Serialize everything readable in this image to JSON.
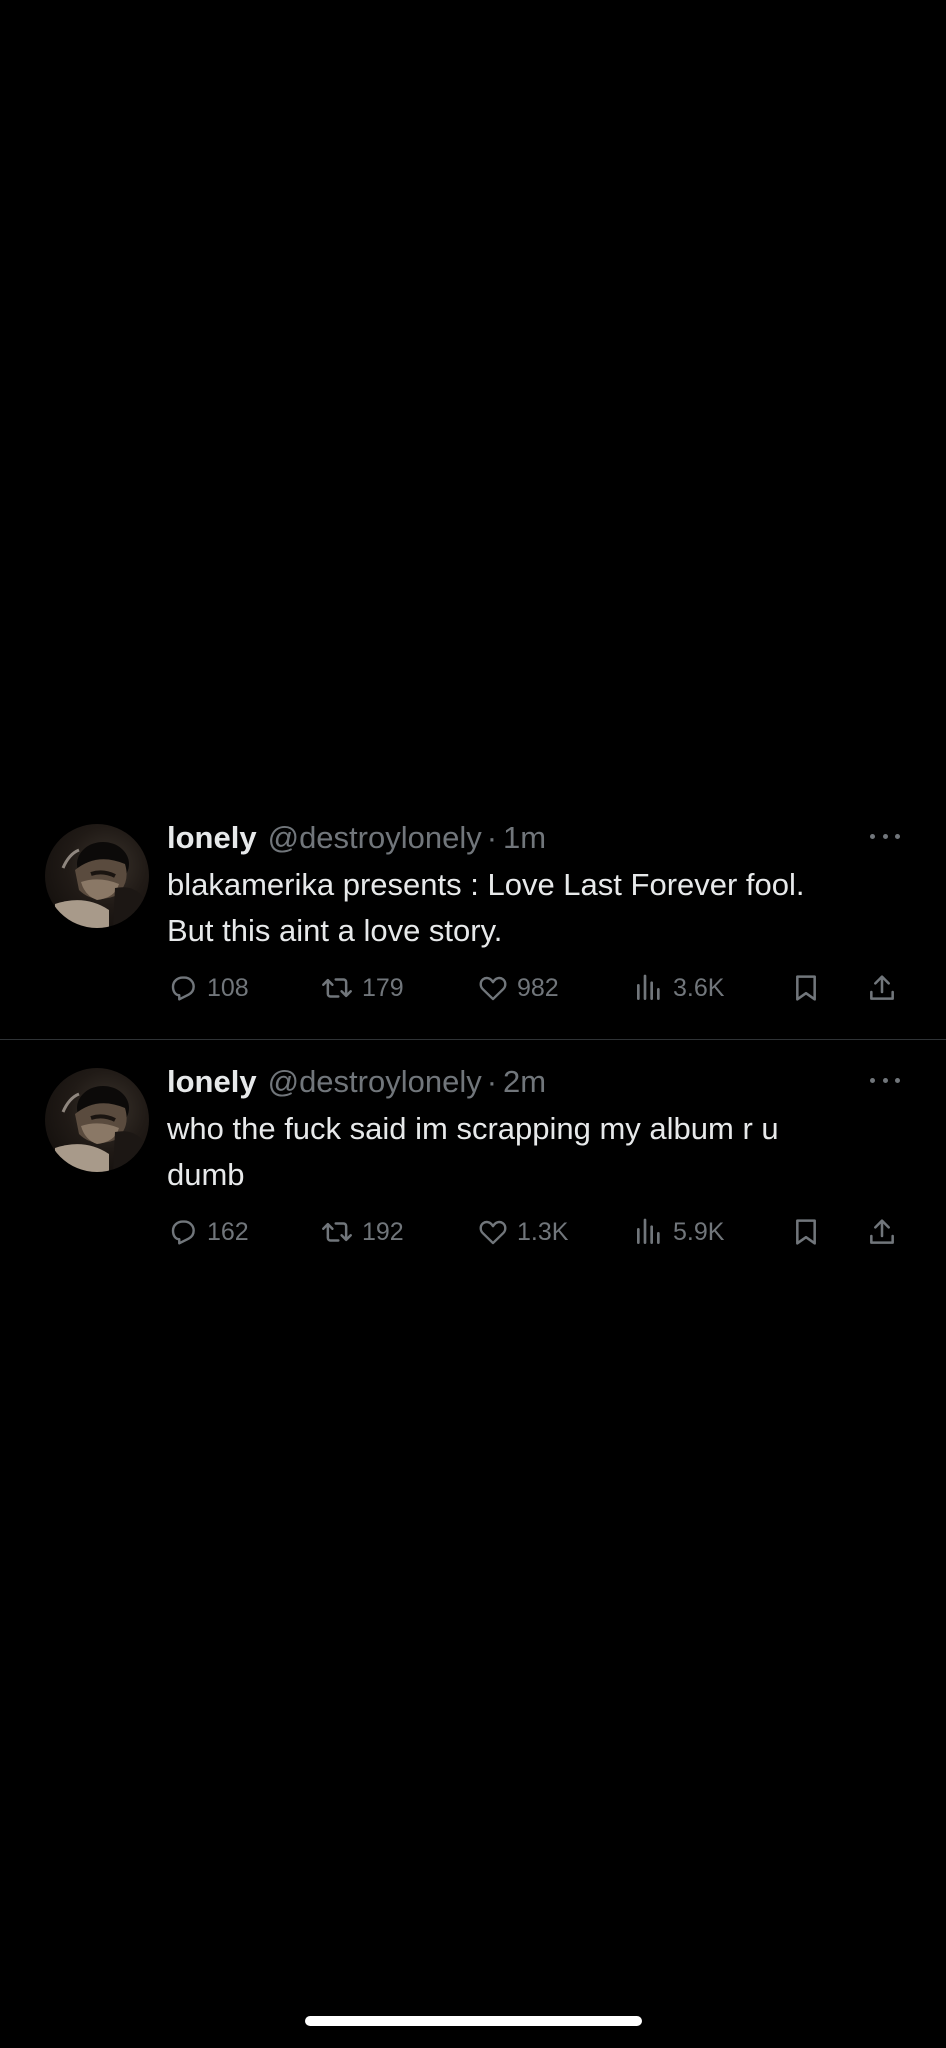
{
  "tweets": [
    {
      "name": "lonely",
      "handle": "@destroylonely",
      "separator": "·",
      "time": "1m",
      "text": "blakamerika presents : Love Last Forever fool.\nBut this aint a love story.",
      "stats": {
        "replies": "108",
        "retweets": "179",
        "likes": "982",
        "views": "3.6K"
      }
    },
    {
      "name": "lonely",
      "handle": "@destroylonely",
      "separator": "·",
      "time": "2m",
      "text": "who the fuck said im scrapping my album r u\ndumb",
      "stats": {
        "replies": "162",
        "retweets": "192",
        "likes": "1.3K",
        "views": "5.9K"
      }
    }
  ],
  "icons": {
    "reply": "reply-icon",
    "retweet": "retweet-icon",
    "like": "heart-icon",
    "views": "views-icon",
    "bookmark": "bookmark-icon",
    "share": "share-icon",
    "more": "more-icon"
  },
  "colors": {
    "background": "#000000",
    "text_primary": "#e7e9ea",
    "text_secondary": "#71767b",
    "divider": "#2f3336"
  }
}
